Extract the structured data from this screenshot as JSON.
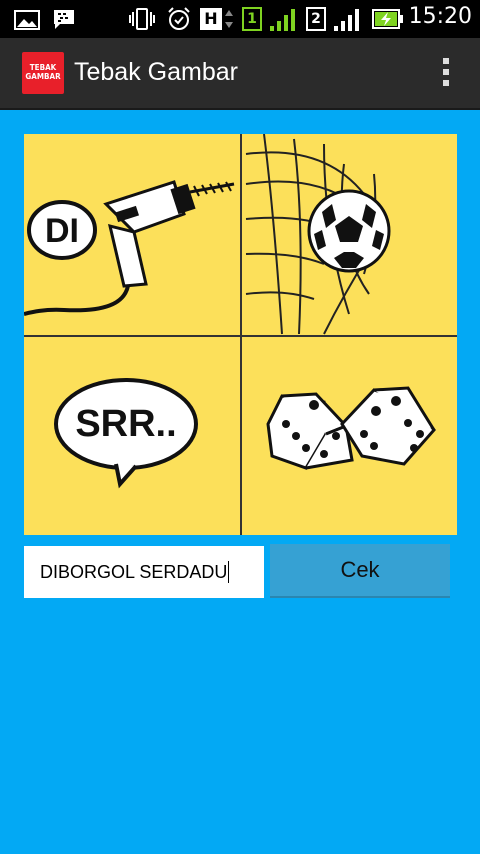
{
  "status_bar": {
    "time": "15:20",
    "icons": [
      "picture-icon",
      "bbm-icon",
      "vibrate-icon",
      "alarm-icon",
      "h-network-icon",
      "sim1-icon",
      "signal-icon",
      "sim2-icon",
      "signal-icon",
      "battery-charging-icon"
    ],
    "sim1_label": "1",
    "sim2_label": "2",
    "network_label": "H"
  },
  "action_bar": {
    "title": "Tebak Gambar",
    "app_icon_line1": "TEBAK",
    "app_icon_line2": "GAMBAR"
  },
  "puzzle": {
    "panel_1_text": "DI",
    "panel_3_text": "SRR..",
    "panels": [
      "drill",
      "soccer-ball-in-net",
      "speech-bubble",
      "dice"
    ]
  },
  "answer": {
    "value": "DIBORGOL SERDADU"
  },
  "check_button": {
    "label": "Cek"
  },
  "colors": {
    "background": "#03a9f4",
    "puzzle_bg": "#fce05a",
    "action_bar": "#2b2b2b",
    "button": "#36a1d3"
  }
}
